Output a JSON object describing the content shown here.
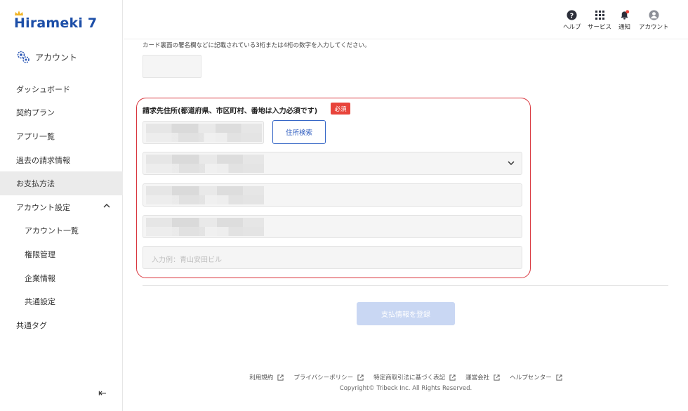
{
  "brand": {
    "logo_text": "Hirameki 7"
  },
  "sidebar": {
    "account_label": "アカウント",
    "items": [
      {
        "label": "ダッシュボード"
      },
      {
        "label": "契約プラン"
      },
      {
        "label": "アプリ一覧"
      },
      {
        "label": "過去の請求情報"
      },
      {
        "label": "お支払方法",
        "active": true
      },
      {
        "label": "アカウント設定",
        "expanded": true
      },
      {
        "label": "アカウント一覧"
      },
      {
        "label": "権限管理"
      },
      {
        "label": "企業情報"
      },
      {
        "label": "共通設定"
      },
      {
        "label": "共通タグ"
      }
    ],
    "collapse_glyph": "⇤"
  },
  "header": {
    "items": [
      {
        "label": "ヘルプ",
        "icon": "help-icon"
      },
      {
        "label": "サービス",
        "icon": "grid-icon"
      },
      {
        "label": "通知",
        "icon": "bell-icon"
      },
      {
        "label": "アカウント",
        "icon": "user-icon"
      }
    ]
  },
  "form": {
    "cvc_hint": "カード裏面の署名欄などに記載されている3桁または4桁の数字を入力してください。",
    "address_label": "請求先住所(都道府県、市区町村、番地は入力必須です)",
    "required_badge": "必須",
    "address_search_label": "住所検索",
    "building_placeholder": "入力例：青山安田ビル",
    "submit_label": "支払情報を登録"
  },
  "footer": {
    "links": [
      {
        "label": "利用規約"
      },
      {
        "label": "プライバシーポリシー"
      },
      {
        "label": "特定商取引法に基づく表記"
      },
      {
        "label": "運営会社"
      },
      {
        "label": "ヘルプセンター"
      }
    ],
    "copyright": "Copyright© Tribeck Inc. All Rights Reserved."
  },
  "colors": {
    "brand": "#1d4fa8",
    "required": "#e8443b",
    "highlight_border": "#d9363e",
    "submit_disabled": "#c9d7f3"
  }
}
